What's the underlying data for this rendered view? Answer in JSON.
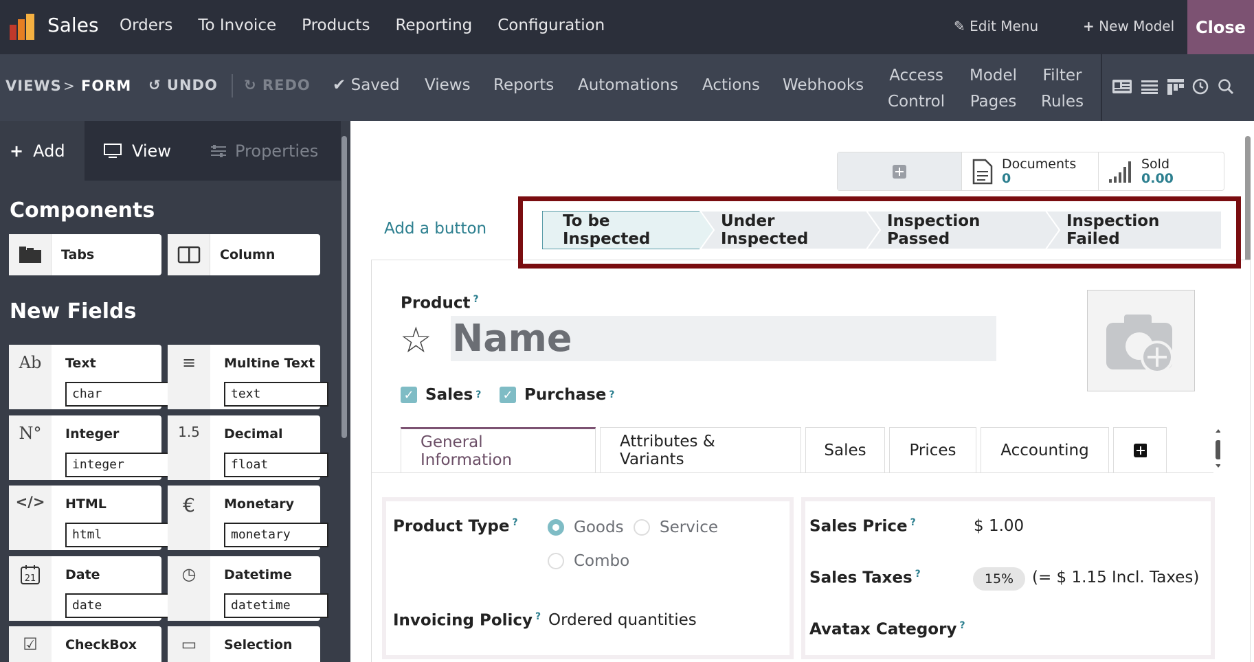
{
  "topbar": {
    "app_name": "Sales",
    "menu": [
      "Orders",
      "To Invoice",
      "Products",
      "Reporting",
      "Configuration"
    ],
    "edit_menu": "Edit Menu",
    "new_model": "New Model",
    "close": "Close"
  },
  "studiobar": {
    "breadcrumb_views": "VIEWS",
    "breadcrumb_sep": ">",
    "breadcrumb_form": "FORM",
    "undo": "UNDO",
    "redo": "REDO",
    "saved": "Saved",
    "menu": [
      "Views",
      "Reports",
      "Automations",
      "Actions",
      "Webhooks"
    ],
    "access_1": "Access",
    "access_2": "Control",
    "model_1": "Model",
    "model_2": "Pages",
    "filter_1": "Filter",
    "filter_2": "Rules"
  },
  "sidebar": {
    "tabs": {
      "add": "Add",
      "view": "View",
      "properties": "Properties"
    },
    "components_title": "Components",
    "components": [
      {
        "label": "Tabs",
        "icon": "tabs-icon"
      },
      {
        "label": "Column",
        "icon": "column-icon"
      }
    ],
    "new_fields_title": "New Fields",
    "fields": [
      {
        "label": "Text",
        "type": "char",
        "icon": "Ab"
      },
      {
        "label": "Multine Text",
        "type": "text",
        "icon": "≡"
      },
      {
        "label": "Integer",
        "type": "integer",
        "icon": "N°"
      },
      {
        "label": "Decimal",
        "type": "float",
        "icon": "1.5"
      },
      {
        "label": "HTML",
        "type": "html",
        "icon": "</>"
      },
      {
        "label": "Monetary",
        "type": "monetary",
        "icon": "€"
      },
      {
        "label": "Date",
        "type": "date",
        "icon": "21"
      },
      {
        "label": "Datetime",
        "type": "datetime",
        "icon": "◷"
      },
      {
        "label": "CheckBox",
        "type": "",
        "icon": "☑"
      },
      {
        "label": "Selection",
        "type": "",
        "icon": "▭"
      }
    ]
  },
  "smart_buttons": {
    "documents_label": "Documents",
    "documents_value": "0",
    "sold_label": "Sold",
    "sold_value": "0.00"
  },
  "form": {
    "add_button": "Add a button",
    "stages": [
      "To be Inspected",
      "Under Inspected",
      "Inspection Passed",
      "Inspection Failed"
    ],
    "product_label": "Product",
    "name_placeholder": "Name",
    "sales_check": "Sales",
    "purchase_check": "Purchase",
    "tabs": [
      "General Information",
      "Attributes & Variants",
      "Sales",
      "Prices",
      "Accounting"
    ],
    "product_type_label": "Product Type",
    "product_type_options": [
      "Goods",
      "Service",
      "Combo"
    ],
    "invoicing_policy_label": "Invoicing Policy",
    "invoicing_policy_value": "Ordered quantities",
    "sales_price_label": "Sales Price",
    "sales_price_value": "$ 1.00",
    "sales_taxes_label": "Sales Taxes",
    "sales_taxes_badge": "15%",
    "sales_taxes_incl": "(= $ 1.15 Incl. Taxes)",
    "avatax_label": "Avatax Category",
    "help_mark": "?"
  },
  "colors": {
    "topbar": "#2b2f3a",
    "studiobar": "#3d4350",
    "close": "#7c5272",
    "accent": "#2c7f8f",
    "highlight": "#7a0d10"
  }
}
